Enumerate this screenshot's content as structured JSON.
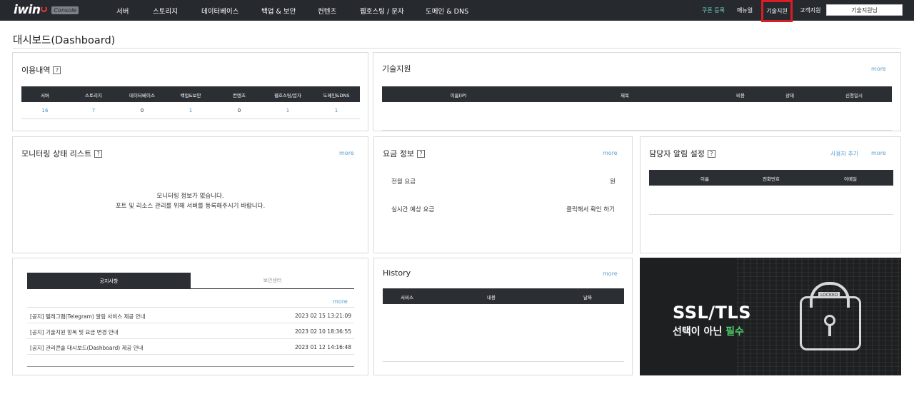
{
  "nav": {
    "logo": "iwin",
    "badge": "Console",
    "menu": [
      "서버",
      "스토리지",
      "데이터베이스",
      "백업 & 보안",
      "컨텐츠",
      "웹호스팅 / 문자",
      "도메인 & DNS"
    ],
    "util": [
      "쿠폰 등록",
      "매뉴얼",
      "기술지원",
      "고객지원"
    ],
    "user": "기술지원님"
  },
  "page_title": "대시보드(Dashboard)",
  "more_label": "more",
  "usage": {
    "title": "이용내역",
    "columns": [
      "서버",
      "스토리지",
      "데이터베이스",
      "백업&보안",
      "컨텐츠",
      "웹호스팅/문자",
      "도메인&DNS"
    ],
    "values": [
      "16",
      "7",
      "0",
      "1",
      "0",
      "1",
      "1"
    ]
  },
  "support": {
    "title": "기술지원",
    "columns": [
      "이름(IP)",
      "제목",
      "비용",
      "상태",
      "신청일시"
    ]
  },
  "monitoring": {
    "title": "모니터링 상태 리스트",
    "empty_line1": "모니터링 정보가 없습니다.",
    "empty_line2": "포트 및 리소스 관리를 위해 서버를 등록해주시기 바랍니다."
  },
  "fee": {
    "title": "요금 정보",
    "prev_label": "전월 요금",
    "prev_value": "원",
    "realtime_label": "실시간 예상 요금",
    "realtime_value": "클릭해서 확인 하기"
  },
  "alert": {
    "title": "담당자 알림 설정",
    "add_user": "사용자 추가",
    "columns": [
      "이름",
      "전화번호",
      "이메일"
    ]
  },
  "notice": {
    "tabs": [
      "공지사항",
      "보안센터"
    ],
    "rows": [
      {
        "title": "[공지] 텔레그램(Telegram) 알림 서비스 제공 안내",
        "date": "2023 02 15 13:21:09"
      },
      {
        "title": "[공지] 기술지원 항목 및 요금 변경 안내",
        "date": "2023 02 10 18:36:55"
      },
      {
        "title": "[공지] 관리콘솔 대시보드(Dashboard) 제공 안내",
        "date": "2023 01 12 14:16:48"
      }
    ]
  },
  "history": {
    "title": "History",
    "columns": [
      "서비스",
      "내용",
      "날짜"
    ]
  },
  "banner": {
    "title": "SSL/TLS",
    "subtitle_prefix": "선택이 아닌",
    "subtitle_accent": "필수",
    "lock_label": "LOCKED",
    "accent_color": "#4fd16b"
  }
}
